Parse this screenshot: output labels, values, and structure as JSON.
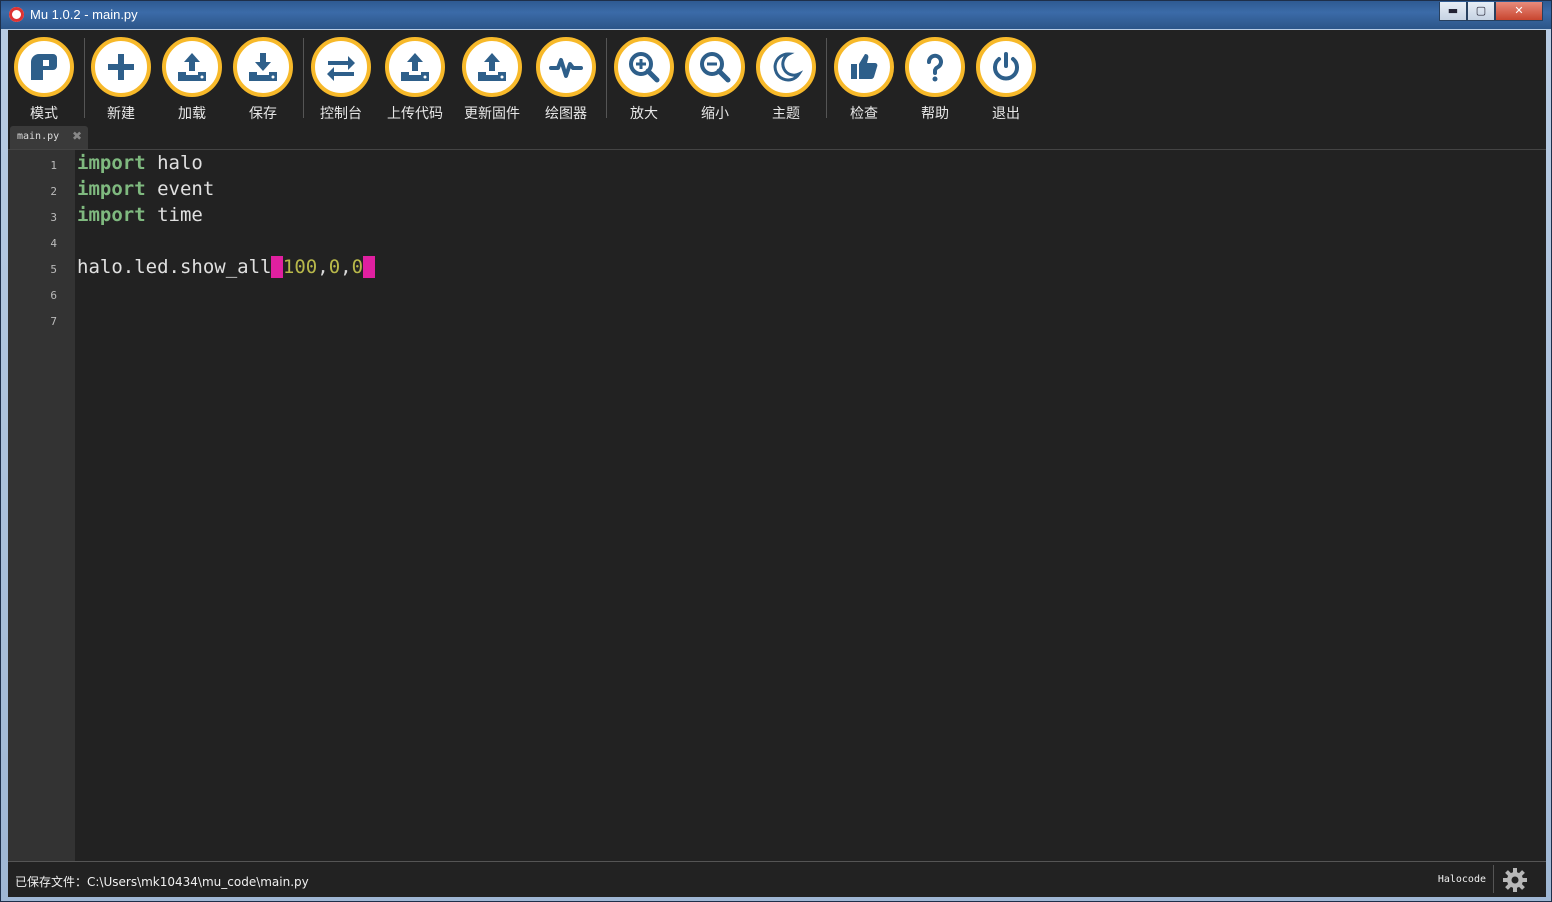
{
  "window": {
    "title": "Mu 1.0.2 - main.py",
    "controls": {
      "minimize": "▬",
      "maximize": "▢",
      "close": "✕"
    }
  },
  "toolbar": {
    "buttons": [
      {
        "label": "模式",
        "icon": "mode-icon"
      },
      {
        "label": "新建",
        "icon": "plus-icon"
      },
      {
        "label": "加载",
        "icon": "upload-icon"
      },
      {
        "label": "保存",
        "icon": "download-icon"
      },
      {
        "label": "控制台",
        "icon": "swap-arrows-icon"
      },
      {
        "label": "上传代码",
        "icon": "upload-icon"
      },
      {
        "label": "更新固件",
        "icon": "upload-icon"
      },
      {
        "label": "绘图器",
        "icon": "pulse-icon"
      },
      {
        "label": "放大",
        "icon": "zoom-in-icon"
      },
      {
        "label": "缩小",
        "icon": "zoom-out-icon"
      },
      {
        "label": "主题",
        "icon": "moon-icon"
      },
      {
        "label": "检查",
        "icon": "thumbs-up-icon"
      },
      {
        "label": "帮助",
        "icon": "question-icon"
      },
      {
        "label": "退出",
        "icon": "power-icon"
      }
    ]
  },
  "tabs": [
    {
      "label": "main.py",
      "close": "✖"
    }
  ],
  "editor": {
    "line_numbers": [
      "1",
      "2",
      "3",
      "4",
      "5",
      "6",
      "7"
    ],
    "lines": {
      "l1": {
        "keyword": "import",
        "rest": " halo"
      },
      "l2": {
        "keyword": "import",
        "rest": " event"
      },
      "l3": {
        "keyword": "import",
        "rest": " time"
      },
      "l5": {
        "call": "halo.led.show_all",
        "open": "(",
        "a1": "100",
        "c1": ",",
        "a2": "0",
        "c2": ",",
        "a3": "0",
        "close": ")"
      }
    }
  },
  "status": {
    "message": "已保存文件：C:\\Users\\mk10434\\mu_code\\main.py",
    "mode": "Halocode"
  },
  "colors": {
    "accent": "#f7b92a",
    "icon_blue": "#2e5f8a",
    "keyword": "#7fb97f",
    "number": "#b8b84a",
    "brace_highlight": "#e020a0",
    "editor_bg": "#222222"
  }
}
